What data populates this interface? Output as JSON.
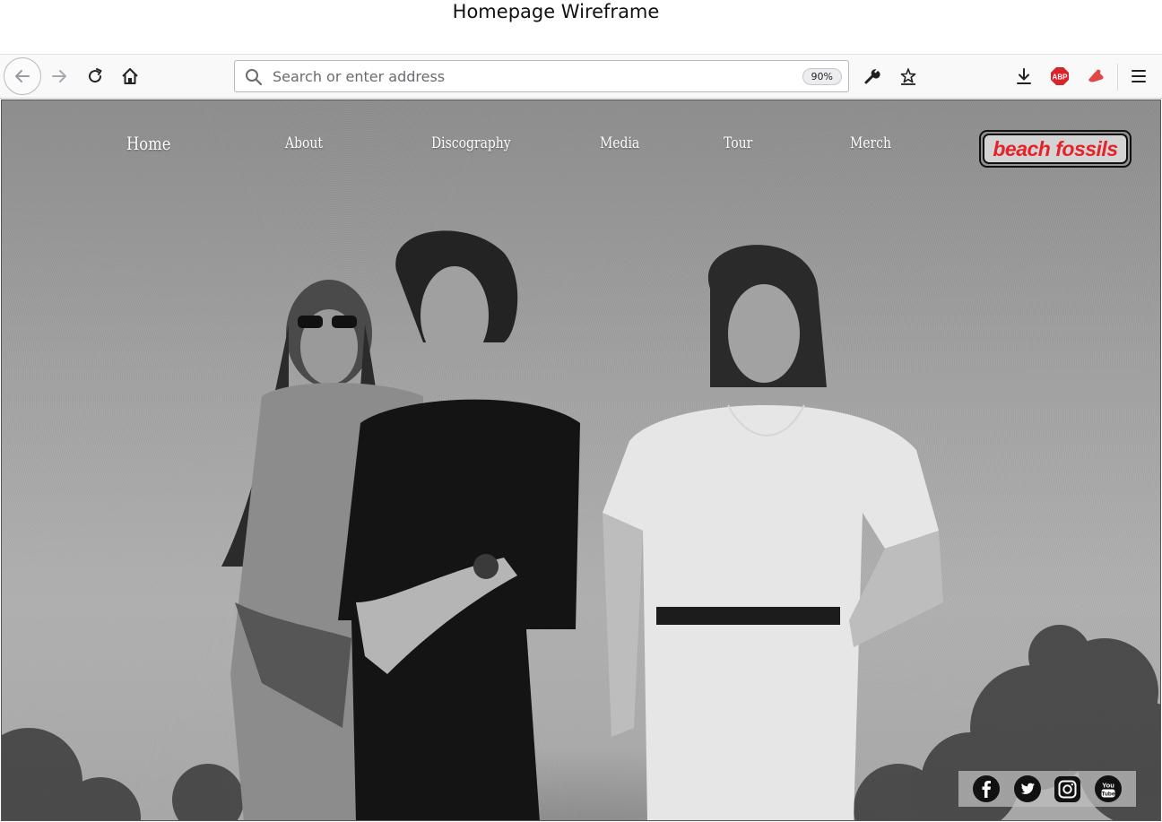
{
  "wireframe_title": "Homepage Wireframe",
  "browser": {
    "search_placeholder": "Search or enter address",
    "zoom": "90%",
    "icons": [
      "back-icon",
      "forward-icon",
      "reload-icon",
      "home-icon",
      "search-icon",
      "wrench-icon",
      "bookmark-star-icon",
      "download-icon",
      "adblock-plus-icon",
      "extension-icon",
      "hamburger-menu-icon"
    ]
  },
  "site": {
    "nav": [
      {
        "label": "Home"
      },
      {
        "label": "About"
      },
      {
        "label": "Discography"
      },
      {
        "label": "Media"
      },
      {
        "label": "Tour"
      },
      {
        "label": "Merch"
      }
    ],
    "logo": "beach fossils",
    "logo_color": "#e5232a",
    "social": [
      "facebook-icon",
      "twitter-icon",
      "instagram-icon",
      "youtube-icon"
    ],
    "social_youtube_text": "You Tube"
  }
}
